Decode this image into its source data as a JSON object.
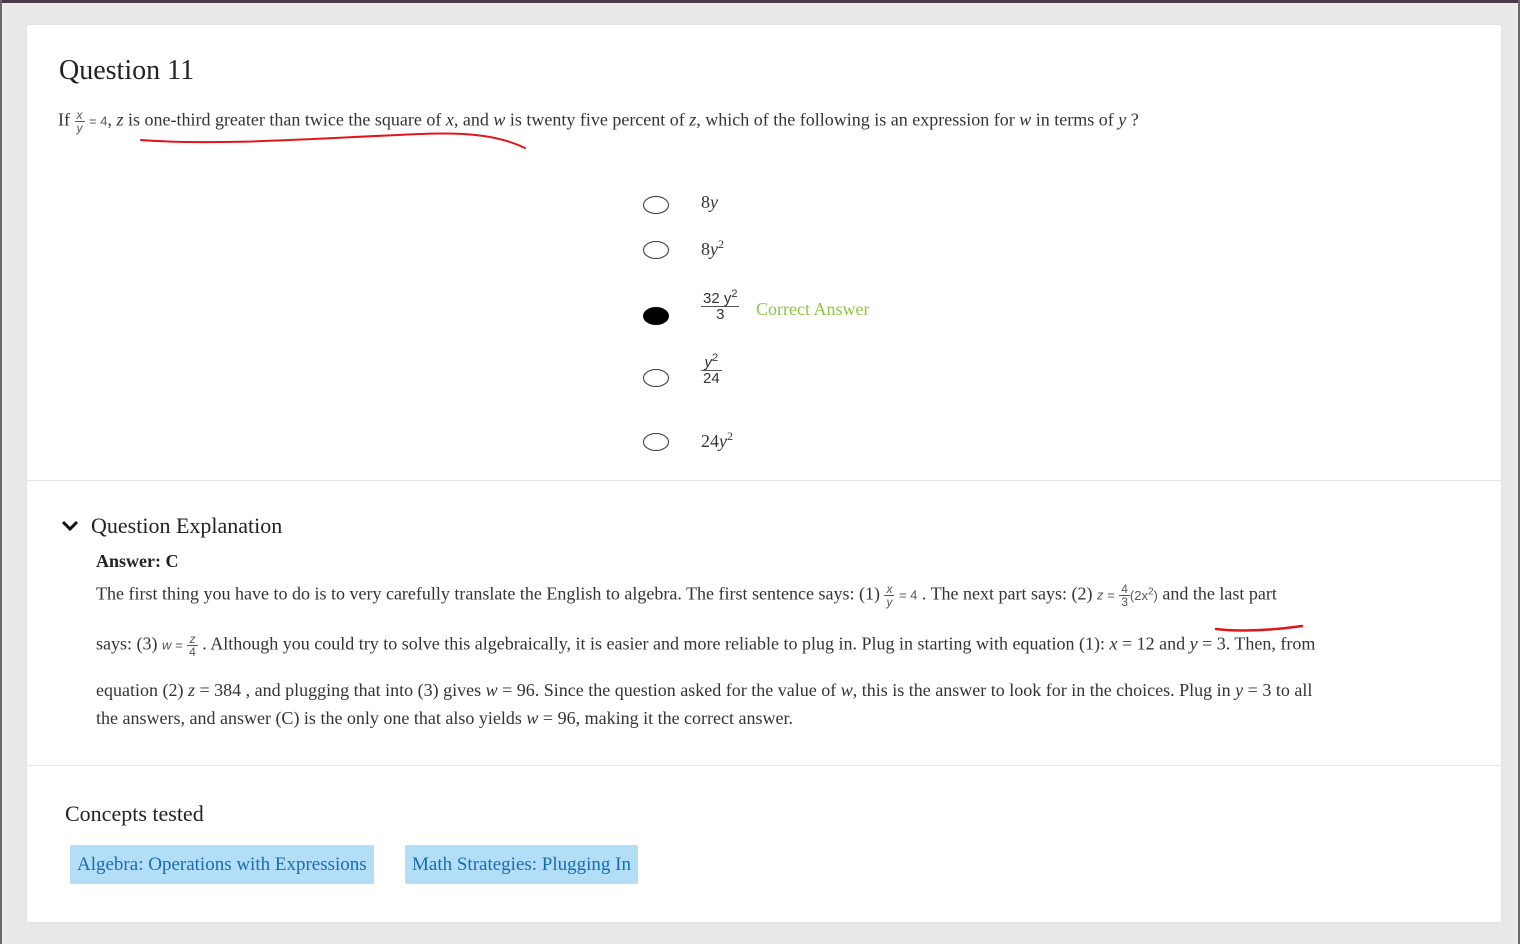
{
  "question": {
    "title": "Question 11",
    "stem": {
      "if": "If",
      "frac_num": "x",
      "frac_den": "y",
      "eq": "= 4",
      "comma": ",",
      "z": "z",
      "part1": " is one-third greater than twice the square of ",
      "x": "x",
      "part2": ", and ",
      "w": "w",
      "part3": " is twenty five percent of ",
      "z2": "z",
      "part4": ", which of the following is an expression for ",
      "w2": "w",
      "part5": " in terms of ",
      "y": "y",
      "qmark": " ?"
    }
  },
  "choices": [
    {
      "coef": "8",
      "var": "y",
      "exp": "",
      "selected": false
    },
    {
      "coef": "8",
      "var": "y",
      "exp": "2",
      "selected": false
    },
    {
      "num": "32 y",
      "num_exp": "2",
      "den": "3",
      "selected": true,
      "feedback": "Correct Answer"
    },
    {
      "num": "y",
      "num_exp": "2",
      "den": "24",
      "selected": false
    },
    {
      "coef": "24",
      "var": "y",
      "exp": "2",
      "selected": false
    }
  ],
  "explanation": {
    "heading": "Question Explanation",
    "answer": "Answer: C",
    "line1": {
      "a": "The first thing you have to do is to very carefully translate the English to algebra. The first sentence says: (1) ",
      "frac_num": "x",
      "frac_den": "y",
      "eq": "= 4",
      "b": " . The next part says: (2) ",
      "z_eq": "z =",
      "frac2_num": "4",
      "frac2_den": "3",
      "paren": "(2x",
      "paren_exp": "2",
      "paren_close": ")",
      "c": "  and the last part"
    },
    "line2": {
      "a": "says: (3) ",
      "w_eq": "w =",
      "frac_num": "z",
      "frac_den": "4",
      "b": " . Although you could try to solve this algebraically, it is easier and more reliable to plug in. Plug in starting with equation (1): ",
      "x": "x",
      "c": " = 12 and ",
      "y": "y",
      "d": " = 3. Then, from"
    },
    "line3": {
      "a": "equation (2) ",
      "z": "z",
      "b": " = 384 , and plugging that into (3) gives ",
      "w": "w",
      "c": " = 96. Since the question asked for the value of ",
      "w2": "w",
      "d": ", this is the answer to look for in the choices. Plug in ",
      "y": "y",
      "e": " = 3 to all"
    },
    "line4": {
      "a": "the answers, and answer (C) is the only one that also yields ",
      "w": "w",
      "b": " = 96, making it the correct answer."
    }
  },
  "concepts": {
    "title": "Concepts tested",
    "tags": [
      "Algebra: Operations with Expressions",
      "Math Strategies: Plugging In"
    ]
  },
  "colors": {
    "correct": "#8dc63f",
    "tag_bg": "#b3def7",
    "tag_text": "#1a6bb0",
    "annotation": "#e0161b"
  }
}
